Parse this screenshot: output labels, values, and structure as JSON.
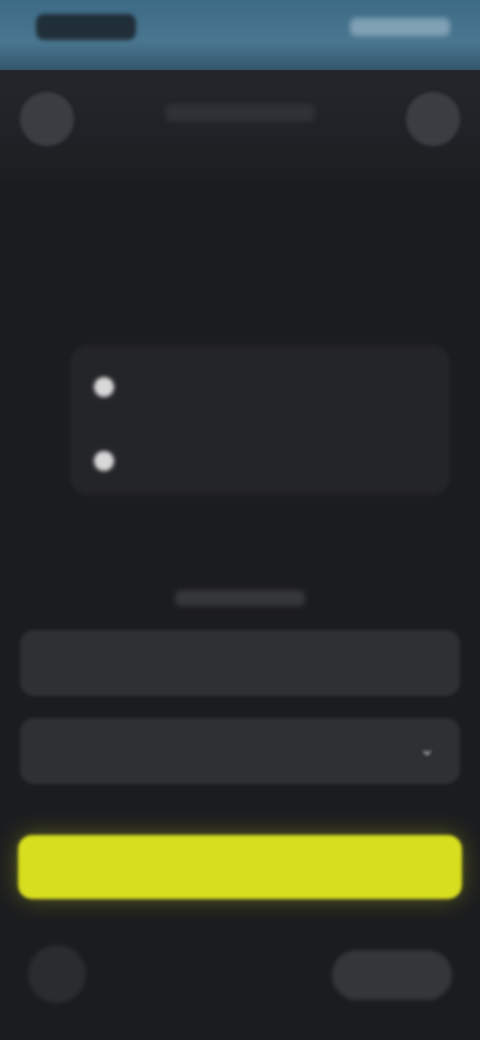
{
  "app": {
    "header_title": "",
    "header_left_icon": "menu-icon",
    "header_right_icon": "profile-icon"
  },
  "hero": {
    "line1": "",
    "line2": "",
    "line3": ""
  },
  "features": [
    {
      "icon": "check-icon",
      "text": ""
    },
    {
      "icon": "check-icon",
      "text": ""
    }
  ],
  "form": {
    "section_label": "",
    "field1_label": "",
    "field1_placeholder": "",
    "field2_label": "",
    "field2_placeholder": "",
    "field2_icon": "chevron-down-icon"
  },
  "cta": {
    "label": ""
  },
  "colors": {
    "accent": "#d7dd1f",
    "background": "#1b1c1f",
    "surface": "#2f3034"
  }
}
